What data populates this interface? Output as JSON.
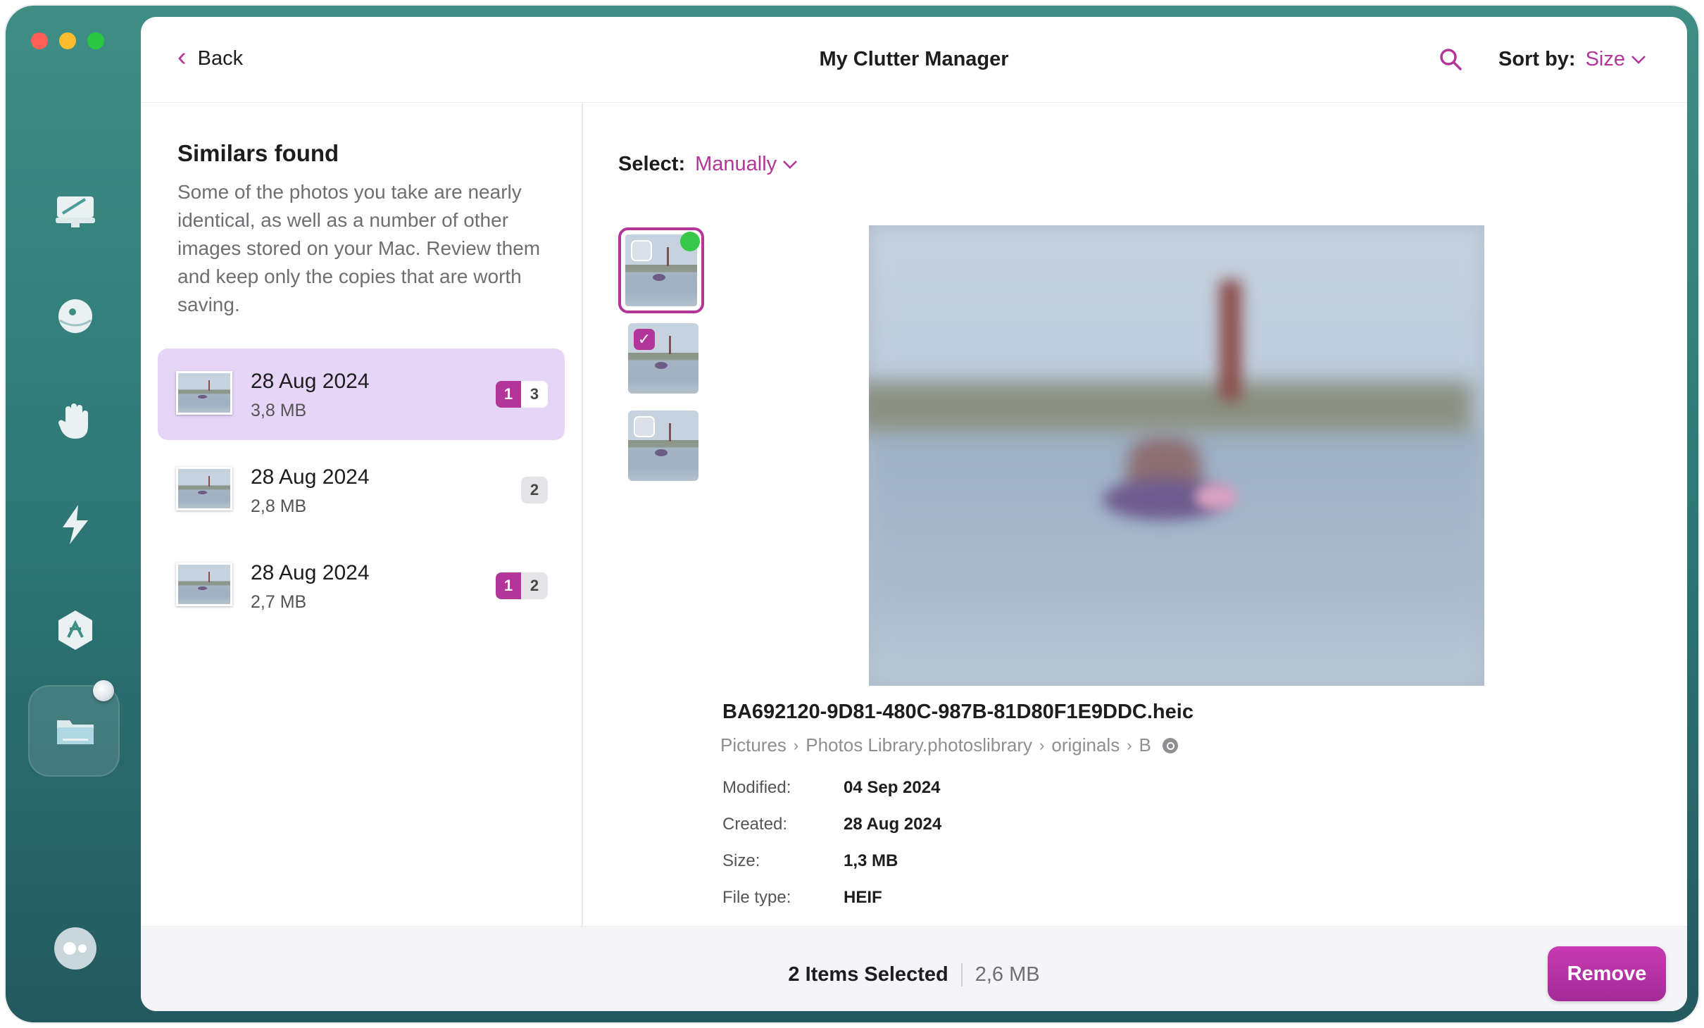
{
  "header": {
    "back_label": "Back",
    "title": "My Clutter Manager",
    "sort_label": "Sort by:",
    "sort_value": "Size"
  },
  "left_pane": {
    "title": "Similars found",
    "description": "Some of the photos you take are nearly identical, as well as a number of other images stored on your Mac. Review them and keep only the copies that are worth saving.",
    "groups": [
      {
        "date": "28 Aug 2024",
        "size": "3,8 MB",
        "selected_count": "1",
        "total_count": "3"
      },
      {
        "date": "28 Aug 2024",
        "size": "2,8 MB",
        "total_count": "2"
      },
      {
        "date": "28 Aug 2024",
        "size": "2,7 MB",
        "selected_count": "1",
        "total_count": "2"
      }
    ]
  },
  "right_pane": {
    "select_label": "Select:",
    "select_value": "Manually",
    "thumbnails": [
      {
        "checked": false,
        "active": true,
        "best": true
      },
      {
        "checked": true,
        "active": false,
        "best": false
      },
      {
        "checked": false,
        "active": false,
        "best": false
      }
    ],
    "file_name": "BA692120-9D81-480C-987B-81D80F1E9DDC.heic",
    "path": [
      "Pictures",
      "Photos Library.photoslibrary",
      "originals",
      "B"
    ],
    "meta": [
      {
        "key": "Modified:",
        "value": "04 Sep 2024"
      },
      {
        "key": "Created:",
        "value": "28 Aug 2024"
      },
      {
        "key": "Size:",
        "value": "1,3 MB"
      },
      {
        "key": "File type:",
        "value": "HEIF"
      }
    ]
  },
  "footer": {
    "selected_label": "2 Items Selected",
    "selected_size": "2,6 MB",
    "remove_label": "Remove"
  },
  "colors": {
    "accent": "#b3359a",
    "selection_bg": "#e6d5f7",
    "sidebar_top": "#3f8e84",
    "sidebar_bottom": "#23595f"
  },
  "icons": {
    "sidebar": [
      "computer-icon",
      "protection-icon",
      "hand-icon",
      "speed-icon",
      "apps-icon",
      "files-icon",
      "assistant-icon"
    ],
    "header": [
      "chevron-left-icon",
      "search-icon",
      "chevron-down-icon"
    ]
  }
}
